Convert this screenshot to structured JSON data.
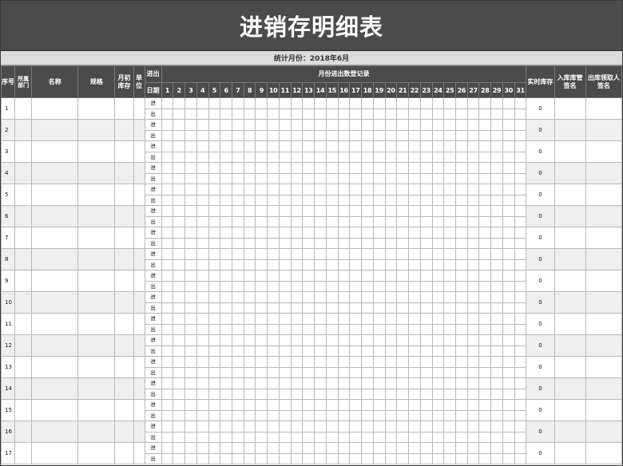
{
  "title": "进销存明细表",
  "stat_label": "统计月份：2018年6月",
  "headers": {
    "seq": "序号",
    "dept": "所属部门",
    "name": "名称",
    "spec": "规格",
    "init_stock": "月初库存",
    "unit": "单位",
    "in_out": "进出",
    "daily_group": "月份进出数登记录",
    "date": "日期",
    "days": [
      "1",
      "2",
      "3",
      "4",
      "5",
      "6",
      "7",
      "8",
      "9",
      "10",
      "11",
      "12",
      "13",
      "14",
      "15",
      "16",
      "17",
      "18",
      "19",
      "20",
      "21",
      "22",
      "23",
      "24",
      "25",
      "26",
      "27",
      "28",
      "29",
      "30",
      "31"
    ],
    "realtime_stock": "实时库存",
    "in_sign": "入库库管签名",
    "out_sign": "出库领取人签名"
  },
  "row_labels": {
    "in": "进",
    "out": "出"
  },
  "rows": [
    {
      "seq": "1",
      "stock": "0"
    },
    {
      "seq": "2",
      "stock": "0"
    },
    {
      "seq": "3",
      "stock": "0"
    },
    {
      "seq": "4",
      "stock": "0"
    },
    {
      "seq": "5",
      "stock": "0"
    },
    {
      "seq": "6",
      "stock": "0"
    },
    {
      "seq": "7",
      "stock": "0"
    },
    {
      "seq": "8",
      "stock": "0"
    },
    {
      "seq": "9",
      "stock": "0"
    },
    {
      "seq": "10",
      "stock": "0"
    },
    {
      "seq": "11",
      "stock": "0"
    },
    {
      "seq": "12",
      "stock": "0"
    },
    {
      "seq": "13",
      "stock": "0"
    },
    {
      "seq": "14",
      "stock": "0"
    },
    {
      "seq": "15",
      "stock": "0"
    },
    {
      "seq": "16",
      "stock": "0"
    },
    {
      "seq": "17",
      "stock": "0"
    }
  ],
  "colors": {
    "header_bg": "#4b4b4b",
    "stat_bg": "#dcdcdc",
    "row_shade": "#efefef",
    "grid": "#b9b9b9"
  }
}
